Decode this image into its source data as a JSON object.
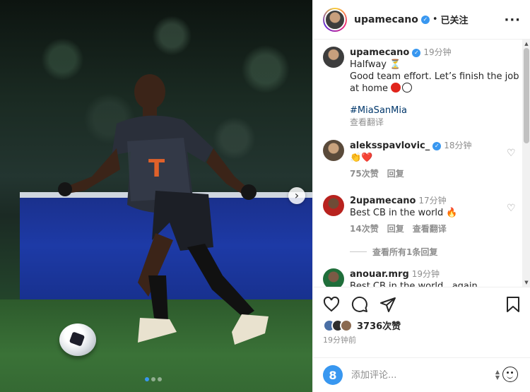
{
  "post": {
    "author": "upamecano",
    "follow_status": "已关注",
    "more_label": "···"
  },
  "caption": {
    "user": "upamecano",
    "time": "19分钟",
    "line1": "Halfway ⏳",
    "line2": "Good team effort. Let’s finish the job at home",
    "hashtag": "#MiaSanMia",
    "translate": "查看翻译"
  },
  "comments": [
    {
      "user": "aleksspavlovic_",
      "verified": true,
      "time": "18分钟",
      "text": "👏❤️",
      "likes": "75次赞",
      "reply": "回复",
      "translate": ""
    },
    {
      "user": "2upamecano",
      "verified": false,
      "time": "17分钟",
      "text": "Best CB in the world 🔥",
      "likes": "14次赞",
      "reply": "回复",
      "translate": "查看翻译"
    },
    {
      "user": "anouar.mrg",
      "verified": false,
      "time": "19分钟",
      "text": "Best CB in the world , again 🍋"
    }
  ],
  "view_replies": "查看所有1条回复",
  "likes_count": "3736次赞",
  "post_time": "19分钟前",
  "add_comment_placeholder": "添加评论...",
  "badge_label": "8",
  "icons": {
    "like": "heart-icon",
    "comment": "comment-icon",
    "share": "paper-plane-icon",
    "save": "bookmark-icon",
    "next": "chevron-right-icon"
  },
  "carousel": {
    "slides": 3,
    "current": 1
  },
  "colors": {
    "accent": "#3897f0",
    "muted": "#8e8e8e",
    "red": "#e0241b"
  }
}
